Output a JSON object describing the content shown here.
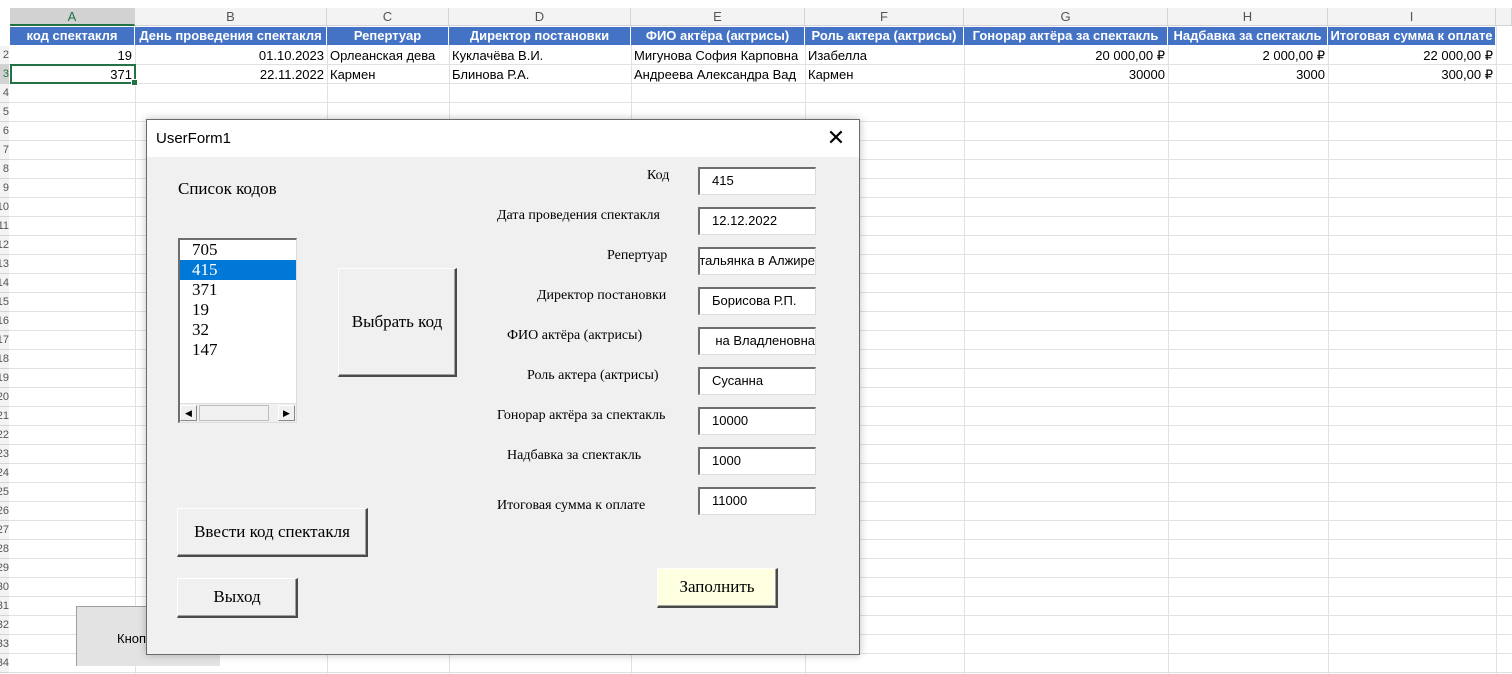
{
  "sheet": {
    "columns": [
      "A",
      "B",
      "C",
      "D",
      "E",
      "F",
      "G",
      "H",
      "I"
    ],
    "row_numbers": [
      "2",
      "3",
      "4",
      "5",
      "6",
      "7",
      "8",
      "9",
      "10",
      "11",
      "12",
      "13",
      "14",
      "15",
      "16",
      "17",
      "18",
      "19",
      "20",
      "21",
      "22",
      "23",
      "24",
      "25",
      "26",
      "27",
      "28",
      "29",
      "30",
      "31",
      "32",
      "33",
      "34"
    ],
    "headers": [
      "код спектакля",
      "День проведения спектакля",
      "Репертуар",
      "Директор постановки",
      "ФИО актёра (актрисы)",
      "Роль актера (актрисы)",
      "Гонорар актёра за спектакль",
      "Надбавка за спектакль",
      "Итоговая сумма к оплате"
    ],
    "rows": [
      [
        "19",
        "01.10.2023",
        "Орлеанская дева",
        "Куклачёва В.И.",
        "Мигунова София Карповна",
        "Изабелла",
        "20 000,00 ₽",
        "2 000,00 ₽",
        "22 000,00 ₽"
      ],
      [
        "371",
        "22.11.2022",
        "Кармен",
        "Блинова Р.А.",
        "Андреева Александра Вад",
        "Кармен",
        "30000",
        "3000",
        "300,00 ₽"
      ]
    ],
    "sheet_button_label": "Кноп"
  },
  "form": {
    "title": "UserForm1",
    "close_glyph": "✕",
    "codes_label": "Список кодов",
    "codes": [
      "705",
      "415",
      "371",
      "19",
      "32",
      "147"
    ],
    "selected_code": "415",
    "choose_button": "Выбрать код",
    "enter_button": "Ввести код спектакля",
    "exit_button": "Выход",
    "fill_button": "Заполнить",
    "fields": [
      {
        "label": "Код",
        "value": "415"
      },
      {
        "label": "Дата проведения спектакля",
        "value": "12.12.2022"
      },
      {
        "label": "Репертуар",
        "value": "тальянка в Алжире"
      },
      {
        "label": "Директор постановки",
        "value": "Борисова Р.П."
      },
      {
        "label": "ФИО актёра (актрисы)",
        "value": "на Владленовна"
      },
      {
        "label": "Роль актера (актрисы)",
        "value": "Сусанна"
      },
      {
        "label": "Гонорар актёра за спектакль",
        "value": "10000"
      },
      {
        "label": "Надбавка за спектакль",
        "value": "1000"
      },
      {
        "label": "Итоговая сумма к оплате",
        "value": "11000"
      }
    ]
  },
  "colors": {
    "header_fill": "#4472c4",
    "selection_green": "#217346",
    "list_selection": "#0078d7",
    "fill_button_bg": "#ffffe1"
  }
}
